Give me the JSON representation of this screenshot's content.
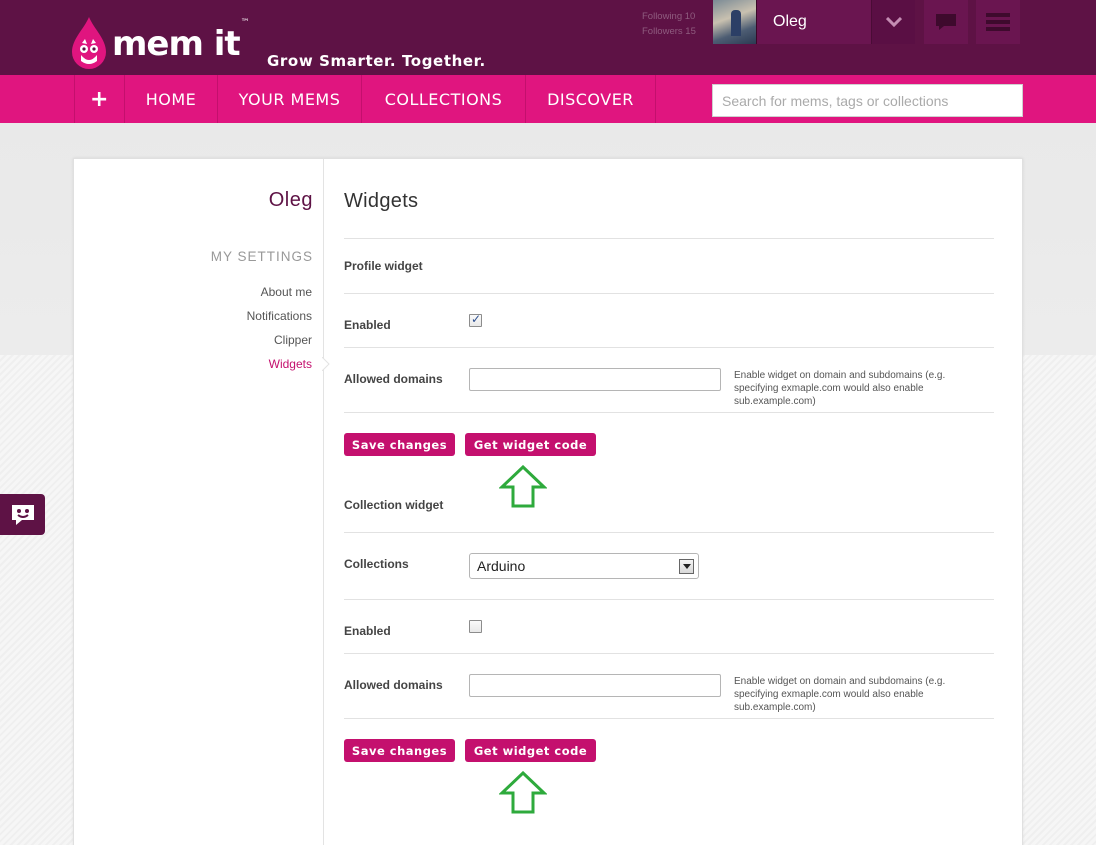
{
  "header": {
    "logo_text": "mem it",
    "logo_tm": "™",
    "tagline": "Grow Smarter. Together.",
    "following": "Following 10",
    "followers": "Followers 15",
    "user_name": "Oleg",
    "icons": [
      "chevron-down-icon",
      "chat-bubble-icon",
      "hamburger-menu-icon"
    ]
  },
  "nav": {
    "plus": "+",
    "items": [
      "HOME",
      "YOUR MEMS",
      "COLLECTIONS",
      "DISCOVER"
    ],
    "search_placeholder": "Search for mems, tags or collections"
  },
  "sidebar": {
    "user": "Oleg",
    "heading": "MY SETTINGS",
    "links": [
      "About me",
      "Notifications",
      "Clipper",
      "Widgets"
    ],
    "active": "Widgets"
  },
  "content": {
    "title": "Widgets",
    "profile_widget": {
      "heading": "Profile widget",
      "enabled_label": "Enabled",
      "enabled": true,
      "domains_label": "Allowed domains",
      "domains_value": "",
      "hint": "Enable widget on domain and subdomains (e.g. specifying exmaple.com would also enable sub.example.com)",
      "save_label": "Save changes",
      "code_label": "Get widget code"
    },
    "collection_widget": {
      "heading": "Collection widget",
      "collections_label": "Collections",
      "collection_selected": "Arduino",
      "enabled_label": "Enabled",
      "enabled": false,
      "domains_label": "Allowed domains",
      "domains_value": "",
      "hint": "Enable widget on domain and subdomains (e.g. specifying exmaple.com would also enable sub.example.com)",
      "save_label": "Save changes",
      "code_label": "Get widget code"
    }
  },
  "colors": {
    "header_bg": "#5e1245",
    "nav_bg": "#e0157f",
    "button_bg": "#c4106e",
    "annotation_arrow": "#2eaa3c"
  }
}
